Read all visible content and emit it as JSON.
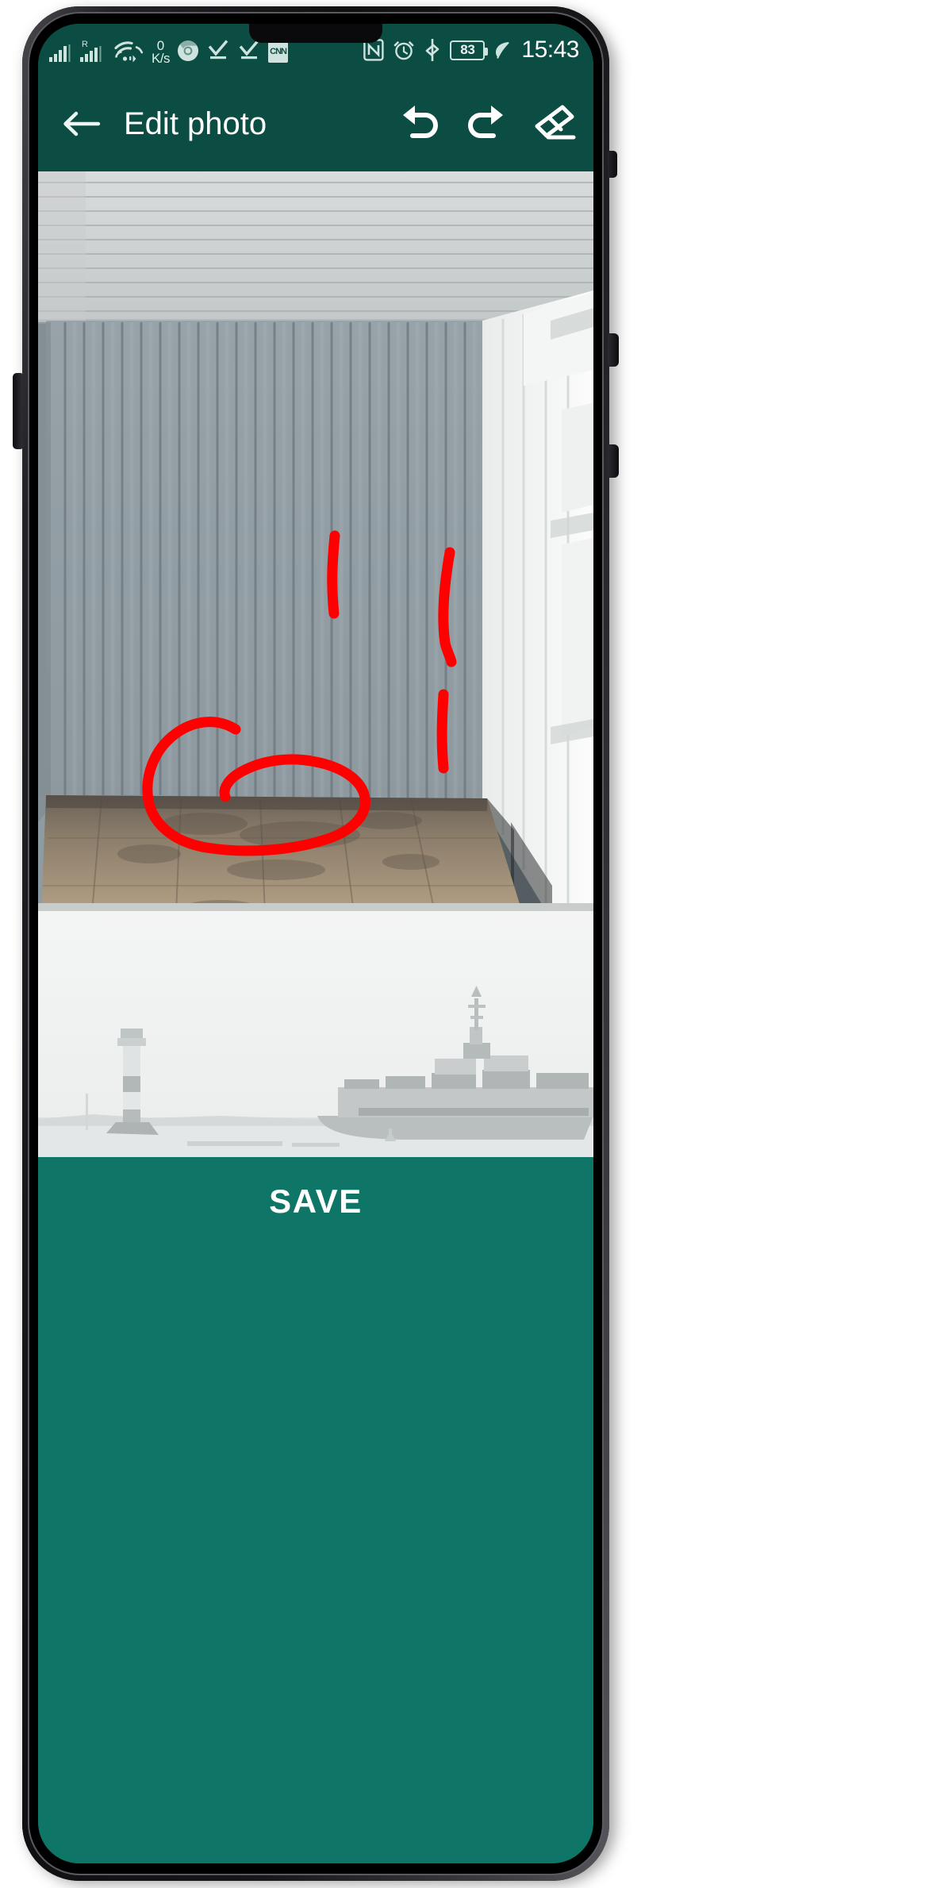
{
  "theme": {
    "status_bar_color": "#0B4D42",
    "app_bar_color": "#0B4D42",
    "save_bar_color": "#0E7567",
    "annotation_color": "#FF0000",
    "on_primary_color": "#FFFFFF"
  },
  "status_bar": {
    "left_icons": [
      {
        "name": "signal-bars-sim1-icon",
        "label": "signal-bars"
      },
      {
        "name": "signal-bars-sim2-roaming-icon",
        "label": "R"
      },
      {
        "name": "wifi-icon",
        "label": "wifi"
      },
      {
        "name": "network-speed-indicator",
        "value": "0",
        "unit": "K/s"
      },
      {
        "name": "chrome-icon",
        "label": "chrome"
      },
      {
        "name": "checkmark-icon-1",
        "label": "check"
      },
      {
        "name": "checkmark-icon-2",
        "label": "check"
      },
      {
        "name": "cnn-app-icon",
        "label": "CNN"
      }
    ],
    "right_icons": [
      {
        "name": "nfc-icon",
        "label": "NFC"
      },
      {
        "name": "alarm-clock-icon",
        "label": "alarm"
      },
      {
        "name": "bluetooth-icon",
        "label": "bluetooth"
      }
    ],
    "battery_percent": "83",
    "battery_saver_icon": "leaf-icon",
    "clock": "15:43"
  },
  "app_bar": {
    "back_icon": "arrow-left-icon",
    "title": "Edit photo",
    "actions": [
      {
        "name": "undo-button",
        "icon": "undo-icon",
        "label": "Undo"
      },
      {
        "name": "redo-button",
        "icon": "redo-icon",
        "label": "Redo"
      },
      {
        "name": "eraser-button",
        "icon": "eraser-icon",
        "label": "Erase"
      }
    ]
  },
  "photo": {
    "name": "shipping-container-interior-photo",
    "description": "Interior of an empty shipping container with corrugated grey-blue side walls, ribbed ceiling and a worn plywood floor",
    "annotations": [
      {
        "name": "annotation-stroke-left-wall",
        "type": "line",
        "color": "#FF0000"
      },
      {
        "name": "annotation-stroke-right-upper",
        "type": "line",
        "color": "#FF0000"
      },
      {
        "name": "annotation-stroke-right-lower",
        "type": "line",
        "color": "#FF0000"
      },
      {
        "name": "annotation-circle-floor",
        "type": "circle",
        "color": "#FF0000"
      }
    ]
  },
  "preview": {
    "name": "harbour-container-ship-preview",
    "description": "Faded greyscale photo of a container ship passing a striped lighthouse in a harbour"
  },
  "save_bar": {
    "save_label": "SAVE"
  }
}
